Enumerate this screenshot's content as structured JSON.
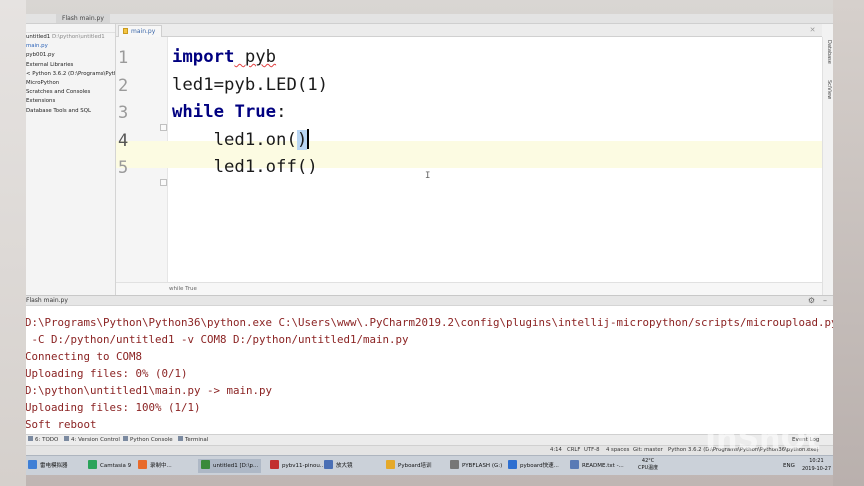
{
  "topbar": {
    "run_config_tab": "Flash main.py"
  },
  "project": {
    "header": "",
    "items": [
      {
        "label": "untitled1",
        "dim": "D:\\python\\untitled1",
        "selected": false
      },
      {
        "label": "main.py",
        "dim": "",
        "selected": true
      },
      {
        "label": "pyb001.py",
        "dim": "",
        "selected": false
      },
      {
        "label": "External Libraries",
        "dim": "",
        "selected": false
      },
      {
        "label": "< Python 3.6.2 (D:\\Programs\\Python\\P",
        "dim": "",
        "selected": false
      },
      {
        "label": "MicroPython",
        "dim": "",
        "selected": false
      },
      {
        "label": "Scratches and Consoles",
        "dim": "",
        "selected": false
      },
      {
        "label": "Extensions",
        "dim": "",
        "selected": false
      },
      {
        "label": "Database Tools and SQL",
        "dim": "",
        "selected": false
      }
    ]
  },
  "editor": {
    "tab_label": "main.py",
    "line_numbers": [
      "1",
      "2",
      "3",
      "4",
      "5"
    ],
    "current_line": 4,
    "lines": {
      "l1_kw": "import",
      "l1_rest": " pyb",
      "l2": "led1=pyb.LED(1)",
      "l3_kw1": "while",
      "l3_kw2": "True",
      "l3_colon": ":",
      "l4_indent": "    led1.on(",
      "l4_close": ")",
      "l5": "    led1.off()"
    },
    "breadcrumb": "while True"
  },
  "right_tools": [
    "Database",
    "SciView"
  ],
  "run_panel": {
    "title": "Flash main.py",
    "console_lines": [
      "D:\\Programs\\Python\\Python36\\python.exe C:\\Users\\www\\.PyCharm2019.2\\config\\plugins\\intellij-micropython/scripts/microupload.py",
      " -C D:/python/untitled1 -v COM8 D:/python/untitled1/main.py",
      "Connecting to COM8",
      "Uploading files: 0% (0/1)",
      "D:\\python\\untitled1\\main.py -> main.py",
      "Uploading files: 100% (1/1)",
      "Soft reboot"
    ],
    "console_color": "#8b2323"
  },
  "tool_tabs": [
    "6: TODO",
    "4: Version Control",
    "Python Console",
    "Terminal"
  ],
  "status_bar": {
    "position": "4:14",
    "line_sep": "CRLF",
    "encoding": "UTF-8",
    "indent": "4 spaces",
    "git": "Git: master",
    "interpreter": "Python 3.6.2 (D:\\Programs\\Python\\Python36\\python.exe)",
    "event_log": "Event Log"
  },
  "taskbar": {
    "items": [
      {
        "label": "雷电模拟器",
        "icon_color": "#3f7fd6",
        "active": false
      },
      {
        "label": "Camtasia 9",
        "icon_color": "#2aa35a",
        "active": false
      },
      {
        "label": "录制中...",
        "icon_color": "#e86a2b",
        "active": false
      },
      {
        "label": "untitled1 [D:\\p...",
        "icon_color": "#3a8a3a",
        "active": true
      },
      {
        "label": "pybv11-pinou...",
        "icon_color": "#c23030",
        "active": false
      },
      {
        "label": "放大镜",
        "icon_color": "#4a6fb5",
        "active": false
      },
      {
        "label": "Pyboard培训",
        "icon_color": "#e5a92a",
        "active": false
      },
      {
        "label": "PYBFLASH (G:)",
        "icon_color": "#777777",
        "active": false
      },
      {
        "label": "pyboard快速...",
        "icon_color": "#2d6fd1",
        "active": false
      },
      {
        "label": "README.txt -...",
        "icon_color": "#5a7bb5",
        "active": false
      }
    ],
    "cpu_temp": "42°C",
    "cpu_label": "CPU温度",
    "lang": "ENG",
    "time": "10:21",
    "date": "2019-10-27"
  },
  "watermark": "InShOt",
  "colors": {
    "keyword": "#000080",
    "current_line": "#fcfbe2",
    "brace_match": "#b9d6f3"
  }
}
